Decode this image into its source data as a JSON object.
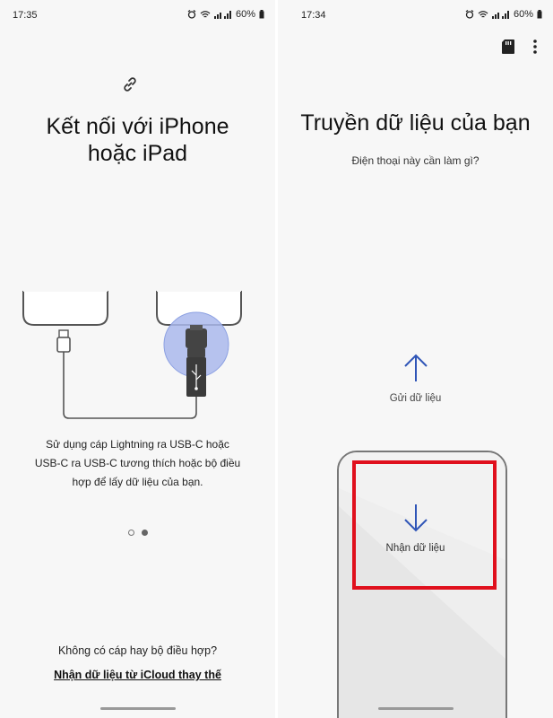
{
  "left_screen": {
    "status": {
      "time": "17:35",
      "battery": "60%"
    },
    "link_icon": "link-icon",
    "title_line1": "Kết nối với iPhone",
    "title_line2": "hoặc iPad",
    "description_line1": "Sử dụng cáp Lightning ra USB-C hoặc",
    "description_line2": "USB-C ra USB-C tương thích hoặc bộ điều",
    "description_line3": "hợp để lấy dữ liệu của bạn.",
    "page_indicator": {
      "total": 2,
      "active": 2
    },
    "no_cable_question": "Không có cáp hay bộ điều hợp?",
    "icloud_link": "Nhận dữ liệu từ iCloud thay thế"
  },
  "right_screen": {
    "status": {
      "time": "17:34",
      "battery": "60%"
    },
    "title": "Truyền dữ liệu của bạn",
    "subtitle": "Điện thoại này cần làm gì?",
    "send_label": "Gửi dữ liệu",
    "receive_label": "Nhận dữ liệu",
    "top_icons": [
      "sd-card-icon",
      "more-vertical-icon"
    ]
  },
  "colors": {
    "accent": "#2f55b7",
    "highlight": "#e0101d",
    "adapter_circle": "#aab8ec"
  }
}
